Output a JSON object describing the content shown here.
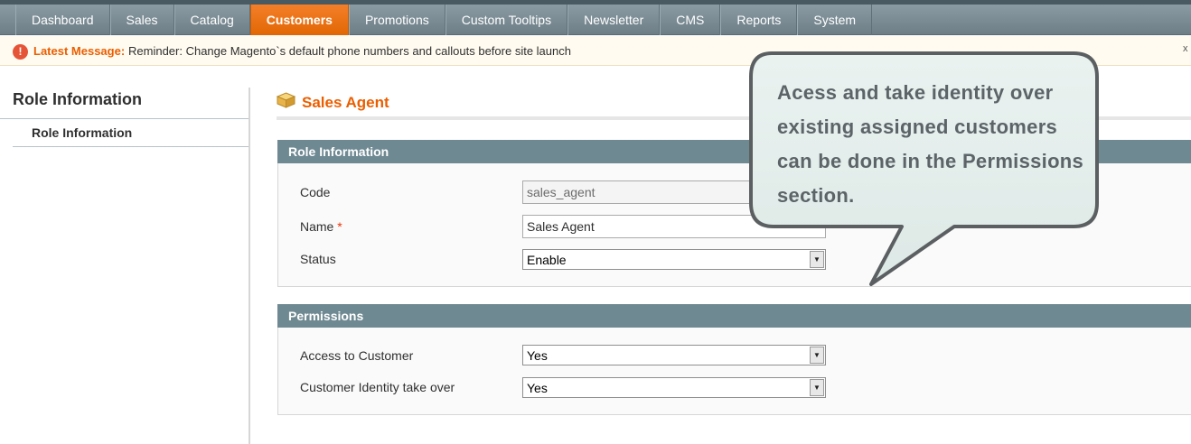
{
  "nav": {
    "items": [
      "Dashboard",
      "Sales",
      "Catalog",
      "Customers",
      "Promotions",
      "Custom Tooltips",
      "Newsletter",
      "CMS",
      "Reports",
      "System"
    ],
    "active": "Customers"
  },
  "message": {
    "label": "Latest Message:",
    "text": "Reminder: Change Magento`s default phone numbers and callouts before site launch",
    "icon": "!",
    "close": "x"
  },
  "sidebar": {
    "title": "Role Information",
    "tab": "Role Information"
  },
  "page": {
    "title": "Sales Agent"
  },
  "role_info": {
    "heading": "Role Information",
    "code_label": "Code",
    "code_value": "sales_agent",
    "name_label": "Name",
    "name_required": "*",
    "name_value": "Sales Agent",
    "status_label": "Status",
    "status_value": "Enable"
  },
  "permissions": {
    "heading": "Permissions",
    "access_label": "Access to Customer",
    "access_value": "Yes",
    "identity_label": "Customer Identity take over",
    "identity_value": "Yes"
  },
  "tooltip": {
    "text": "Acess and take identity over existing assigned customers can be done in the Permissions section."
  },
  "colors": {
    "accent": "#eb5e00",
    "fieldset_header": "#6f8992",
    "nav_bg": "#7d8e96"
  }
}
